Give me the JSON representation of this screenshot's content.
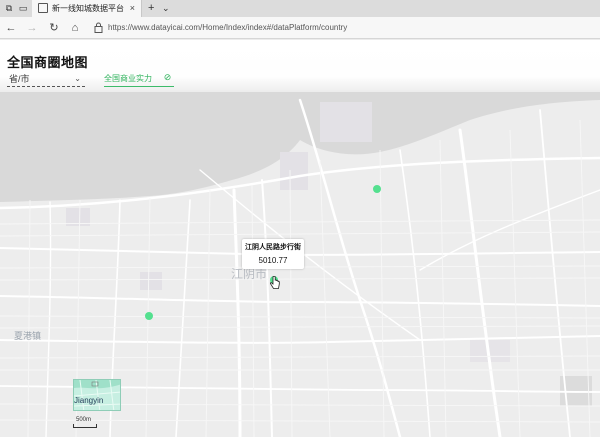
{
  "browser": {
    "tab_title": "新一线知城数据平台",
    "url": "https://www.datayicai.com/Home/Index/index#/dataPlatform/country",
    "tab_close_glyph": "×",
    "new_tab_glyph": "+",
    "tab_menu_glyph": "⌄",
    "back_glyph": "←",
    "forward_glyph": "→",
    "refresh_glyph": "↻",
    "home_glyph": "⌂",
    "icons": [
      "window-icon",
      "tab-list-icon",
      "page-icon",
      "lock-icon"
    ]
  },
  "header": {
    "title": "全国商圈地图",
    "province_select": {
      "value": "省/市",
      "arrow": "⌄"
    },
    "metric_tab": {
      "label": "全国商业实力",
      "icon": "⊘"
    }
  },
  "tooltip": {
    "name": "江阴人民路步行街",
    "value": "5010.77"
  },
  "markers": [
    {
      "id": "marker-north-east",
      "color": "#54e08f"
    },
    {
      "id": "marker-west",
      "color": "#54e08f"
    },
    {
      "id": "marker-center",
      "color": "#54e08f"
    }
  ],
  "map_labels": {
    "town": "夏港镇",
    "city": "江阴市",
    "minimap_city": "Jiangyin",
    "scale": "500m"
  },
  "colors": {
    "accent": "#2fb35c",
    "marker": "#54e08f",
    "map_background": "#ededed",
    "river": "#d9d9d9",
    "road": "#ffffff"
  }
}
